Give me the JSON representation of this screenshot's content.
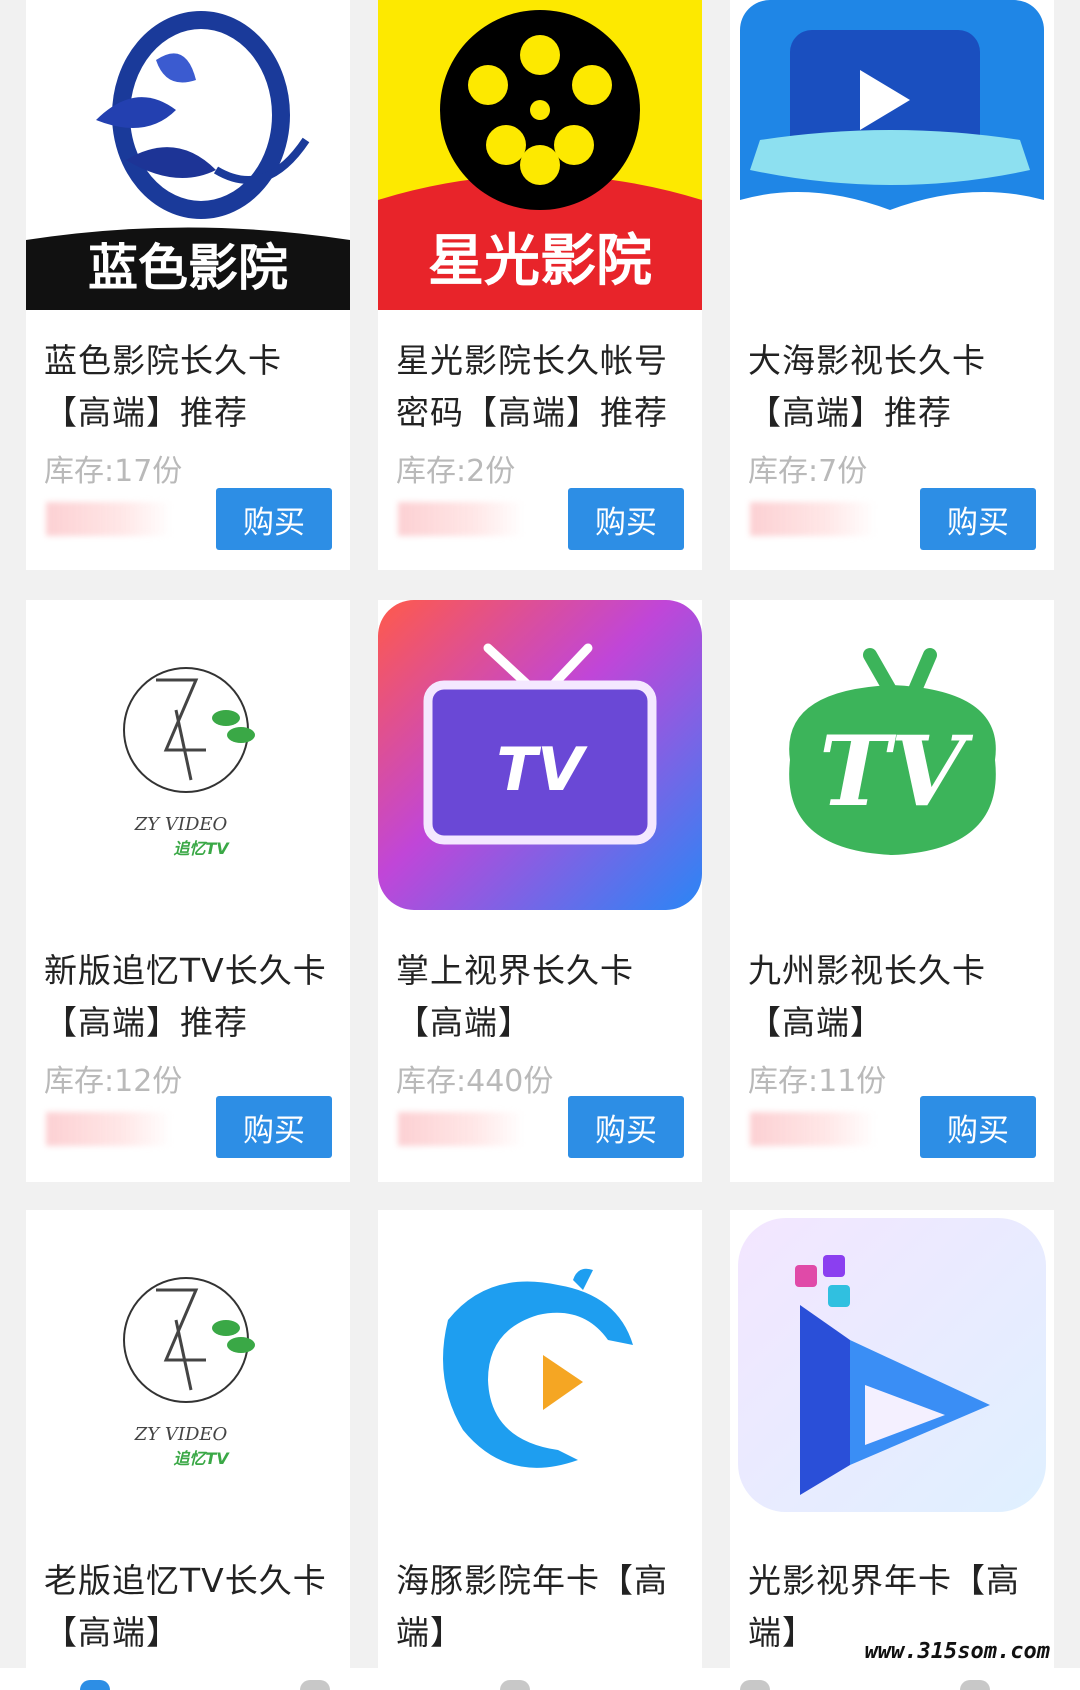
{
  "products": [
    {
      "title": "蓝色影院长久卡【高端】推荐",
      "stock": "库存:17份",
      "buy": "购买",
      "logo_text": "蓝色影院"
    },
    {
      "title": "星光影院长久帐号密码【高端】推荐",
      "stock": "库存:2份",
      "buy": "购买",
      "logo_text": "星光影院"
    },
    {
      "title": "大海影视长久卡【高端】推荐",
      "stock": "库存:7份",
      "buy": "购买"
    },
    {
      "title": "新版追忆TV长久卡【高端】推荐",
      "stock": "库存:12份",
      "buy": "购买",
      "logo_text": "ZY VIDEO",
      "logo_sub": "追忆TV"
    },
    {
      "title": "掌上视界长久卡【高端】",
      "stock": "库存:440份",
      "buy": "购买",
      "logo_text": "TV"
    },
    {
      "title": "九州影视长久卡【高端】",
      "stock": "库存:11份",
      "buy": "购买",
      "logo_text": "TV"
    },
    {
      "title": "老版追忆TV长久卡【高端】",
      "logo_text": "ZY VIDEO",
      "logo_sub": "追忆TV"
    },
    {
      "title": "海豚影院年卡【高端】"
    },
    {
      "title": "光影视界年卡【高端】"
    }
  ],
  "watermark": "www.315som.com",
  "colors": {
    "buy_button": "#2d8ee5",
    "stock_text": "#b9b9b9",
    "background": "#f1f1f1"
  }
}
